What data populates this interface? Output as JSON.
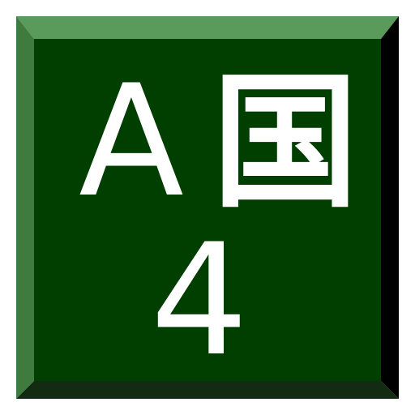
{
  "icon": {
    "name": "input-method-icon",
    "latin_letter": "A",
    "cjk_character": "国",
    "number": "4"
  },
  "colors": {
    "face": "#003f00",
    "bevel_top": "#5a9a5a",
    "bevel_left": "#3f7a3f",
    "bevel_right": "#000000",
    "bevel_bottom": "#132b13",
    "glyph": "#ffffff"
  }
}
